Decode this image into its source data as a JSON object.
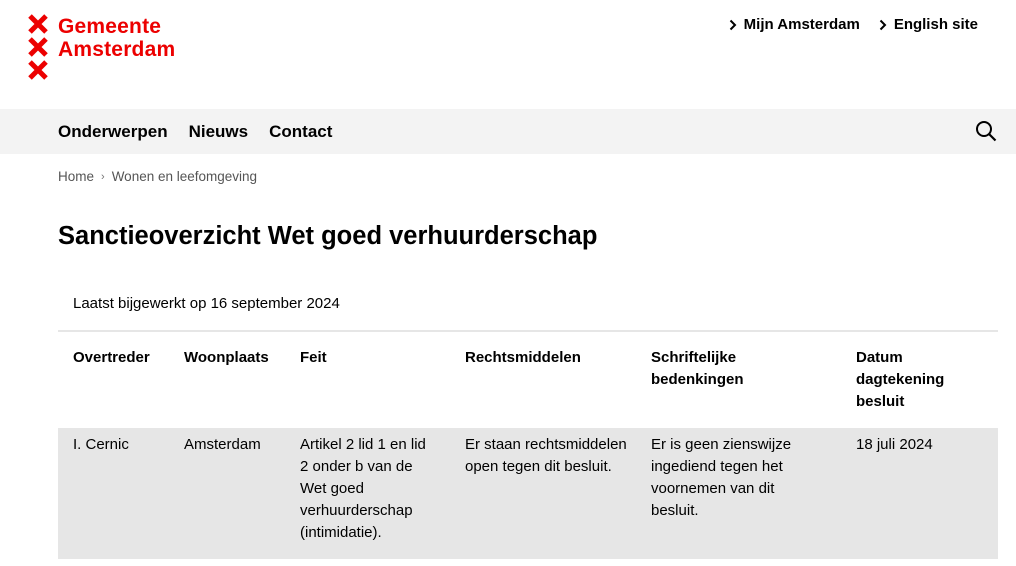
{
  "brand": {
    "line1": "Gemeente",
    "line2": "Amsterdam",
    "color": "#ec0000"
  },
  "toplinks": [
    {
      "label": "Mijn Amsterdam"
    },
    {
      "label": "English site"
    }
  ],
  "nav": {
    "items": [
      {
        "label": "Onderwerpen"
      },
      {
        "label": "Nieuws"
      },
      {
        "label": "Contact"
      }
    ],
    "search_icon": "search-icon"
  },
  "breadcrumb": [
    {
      "label": "Home"
    },
    {
      "label": "Wonen en leefomgeving"
    }
  ],
  "page": {
    "title": "Sanctieoverzicht Wet goed verhuurderschap",
    "updated": "Laatst bijgewerkt op 16 september 2024"
  },
  "table": {
    "headers": [
      "Overtreder",
      "Woonplaats",
      "Feit",
      "Rechtsmiddelen",
      "Schriftelijke bedenkingen",
      "Datum dagtekening besluit"
    ],
    "rows": [
      [
        "I. Cernic",
        "Amsterdam",
        "Artikel 2 lid 1 en lid 2 onder b van de Wet goed verhuurderschap (intimidatie).",
        "Er staan rechtsmiddelen open tegen dit besluit.",
        "Er is geen zienswijze ingediend tegen het voornemen van dit besluit.",
        "18 juli 2024"
      ]
    ]
  }
}
